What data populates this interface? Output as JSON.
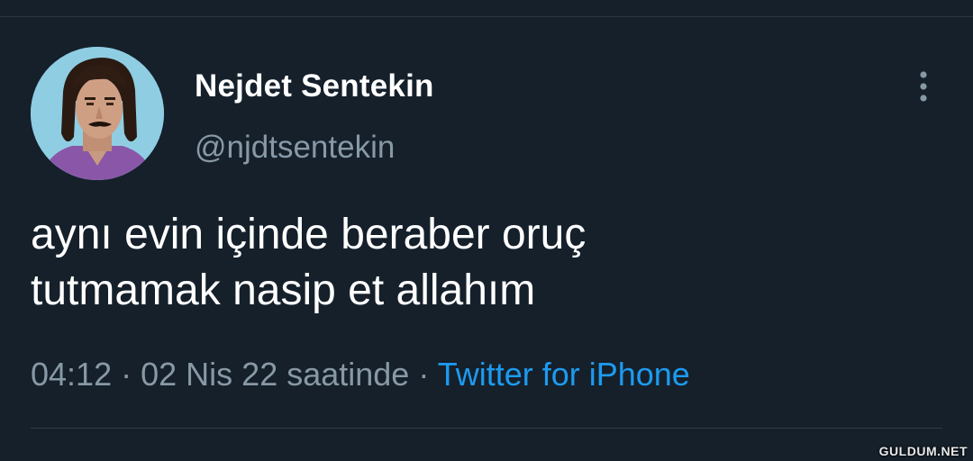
{
  "tweet": {
    "author": {
      "display_name": "Nejdet Sentekin",
      "handle": "@njdtsentekin",
      "avatar_icon": "profile-photo"
    },
    "text": "aynı evin içinde beraber oruç\ntutmamak nasip et allahım",
    "time": "04:12",
    "separator": "·",
    "date": "02 Nis 22 saatinde",
    "source": "Twitter for iPhone",
    "more_icon": "more-vertical-icon"
  },
  "watermark": {
    "text": "GULDUM.NET"
  },
  "colors": {
    "background": "#15202b",
    "primary_text": "#ffffff",
    "secondary_text": "#8899a6",
    "link": "#1d9bf0",
    "divider": "#2f3b46"
  }
}
